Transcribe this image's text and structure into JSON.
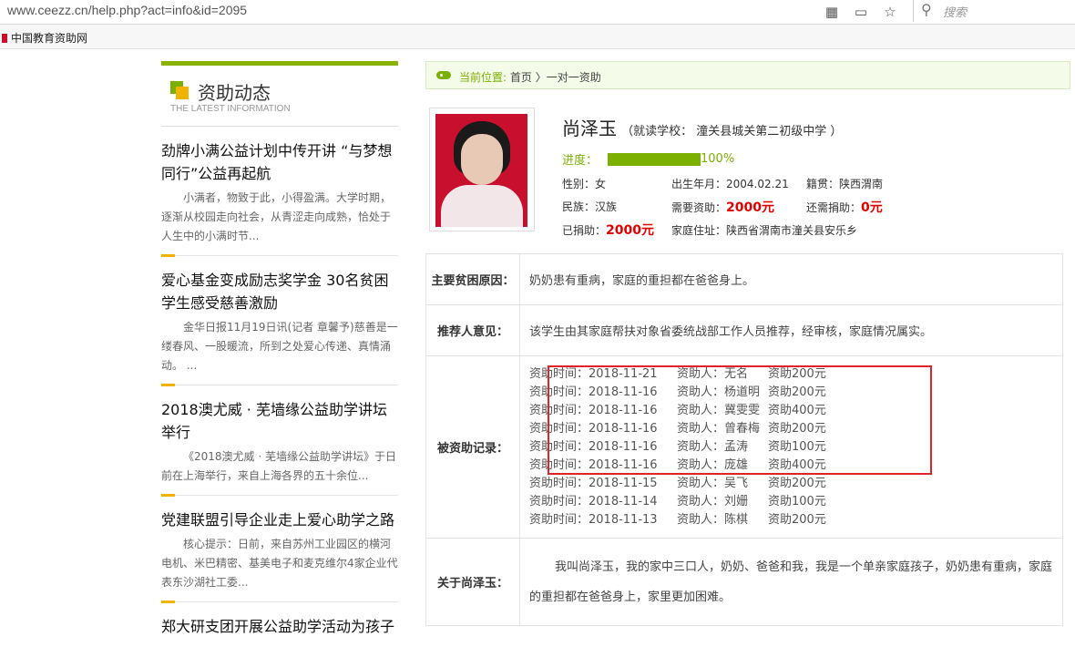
{
  "browser": {
    "url": "www.ceezz.cn/help.php?act=info&id=2095",
    "search_placeholder": "搜索",
    "bookmark": "中国教育资助网"
  },
  "sidebar": {
    "title": "资助动态",
    "subtitle": "THE LATEST INFORMATION",
    "news": [
      {
        "title": "劲牌小满公益计划中传开讲 “与梦想同行”公益再起航",
        "desc": "小满者，物致于此，小得盈满。大学时期，逐渐从校园走向社会，从青涩走向成熟，恰处于人生中的小满时节..."
      },
      {
        "title": "爱心基金变成励志奖学金 30名贫困学生感受慈善激励",
        "desc": "金华日报11月19日讯(记者 章馨予)慈善是一缕春风、一股暖流，所到之处爱心传递、真情涌动。 ..."
      },
      {
        "title": "2018澳尤威 · 芜墙缘公益助学讲坛举行",
        "desc": "《2018澳尤威 · 芜墙缘公益助学讲坛》于日前在上海举行，来自上海各界的五十余位..."
      },
      {
        "title": "党建联盟引导企业走上爱心助学之路",
        "desc": "核心提示：日前，来自苏州工业园区的横河电机、米巴精密、基美电子和麦克维尔4家企业代表东沙湖社工委..."
      },
      {
        "title": "郑大研支团开展公益助学活动为孩子",
        "desc": ""
      }
    ]
  },
  "breadcrumb": {
    "label": "当前位置:",
    "home": "首页",
    "sep": "〉",
    "current": "一对一资助"
  },
  "student": {
    "name": "尚泽玉",
    "school": "（就读学校： 潼关县城关第二初级中学 ）",
    "progress_label": "进度：",
    "progress_value": 1.0,
    "progress_text": "100%",
    "gender": "性别：女",
    "birth": "出生年月：2004.02.21",
    "origin": "籍贯：陕西渭南",
    "ethnic": "民族：汉族",
    "need_label": "需要资助：",
    "need_value": "2000元",
    "still_label": "还需捐助：",
    "still_value": "0元",
    "donated_label": "已捐助：",
    "donated_value": "2000元",
    "address": "家庭住址：陕西省渭南市潼关县安乐乡"
  },
  "table": {
    "reason_label": "主要贫困原因：",
    "reason": "奶奶患有重病，家庭的重担都在爸爸身上。",
    "recommend_label": "推荐人意见：",
    "recommend": "该学生由其家庭帮扶对象省委统战部工作人员推荐，经审核，家庭情况属实。",
    "records_label": "被资助记录：",
    "records": [
      {
        "time": "资助时间：2018-11-21",
        "person": "资助人：无名",
        "amount": "资助200元"
      },
      {
        "time": "资助时间：2018-11-16",
        "person": "资助人：杨道明",
        "amount": "资助200元"
      },
      {
        "time": "资助时间：2018-11-16",
        "person": "资助人：冀雯雯",
        "amount": "资助400元"
      },
      {
        "time": "资助时间：2018-11-16",
        "person": "资助人：曾春梅",
        "amount": "资助200元"
      },
      {
        "time": "资助时间：2018-11-16",
        "person": "资助人：孟涛",
        "amount": "资助100元"
      },
      {
        "time": "资助时间：2018-11-16",
        "person": "资助人：庞雄",
        "amount": "资助400元"
      },
      {
        "time": "资助时间：2018-11-15",
        "person": "资助人：吴飞",
        "amount": "资助200元"
      },
      {
        "time": "资助时间：2018-11-14",
        "person": "资助人：刘姗",
        "amount": "资助100元"
      },
      {
        "time": "资助时间：2018-11-13",
        "person": "资助人：陈棋",
        "amount": "资助200元"
      }
    ],
    "about_label": "关于尚泽玉：",
    "about": "我叫尚泽玉，我的家中三口人，奶奶、爸爸和我，我是一个单亲家庭孩子，奶奶患有重病，家庭的重担都在爸爸身上，家里更加困难。"
  },
  "colors": {
    "accent": "#7bb000",
    "highlight": "#e0232b",
    "amount": "#e00000"
  }
}
